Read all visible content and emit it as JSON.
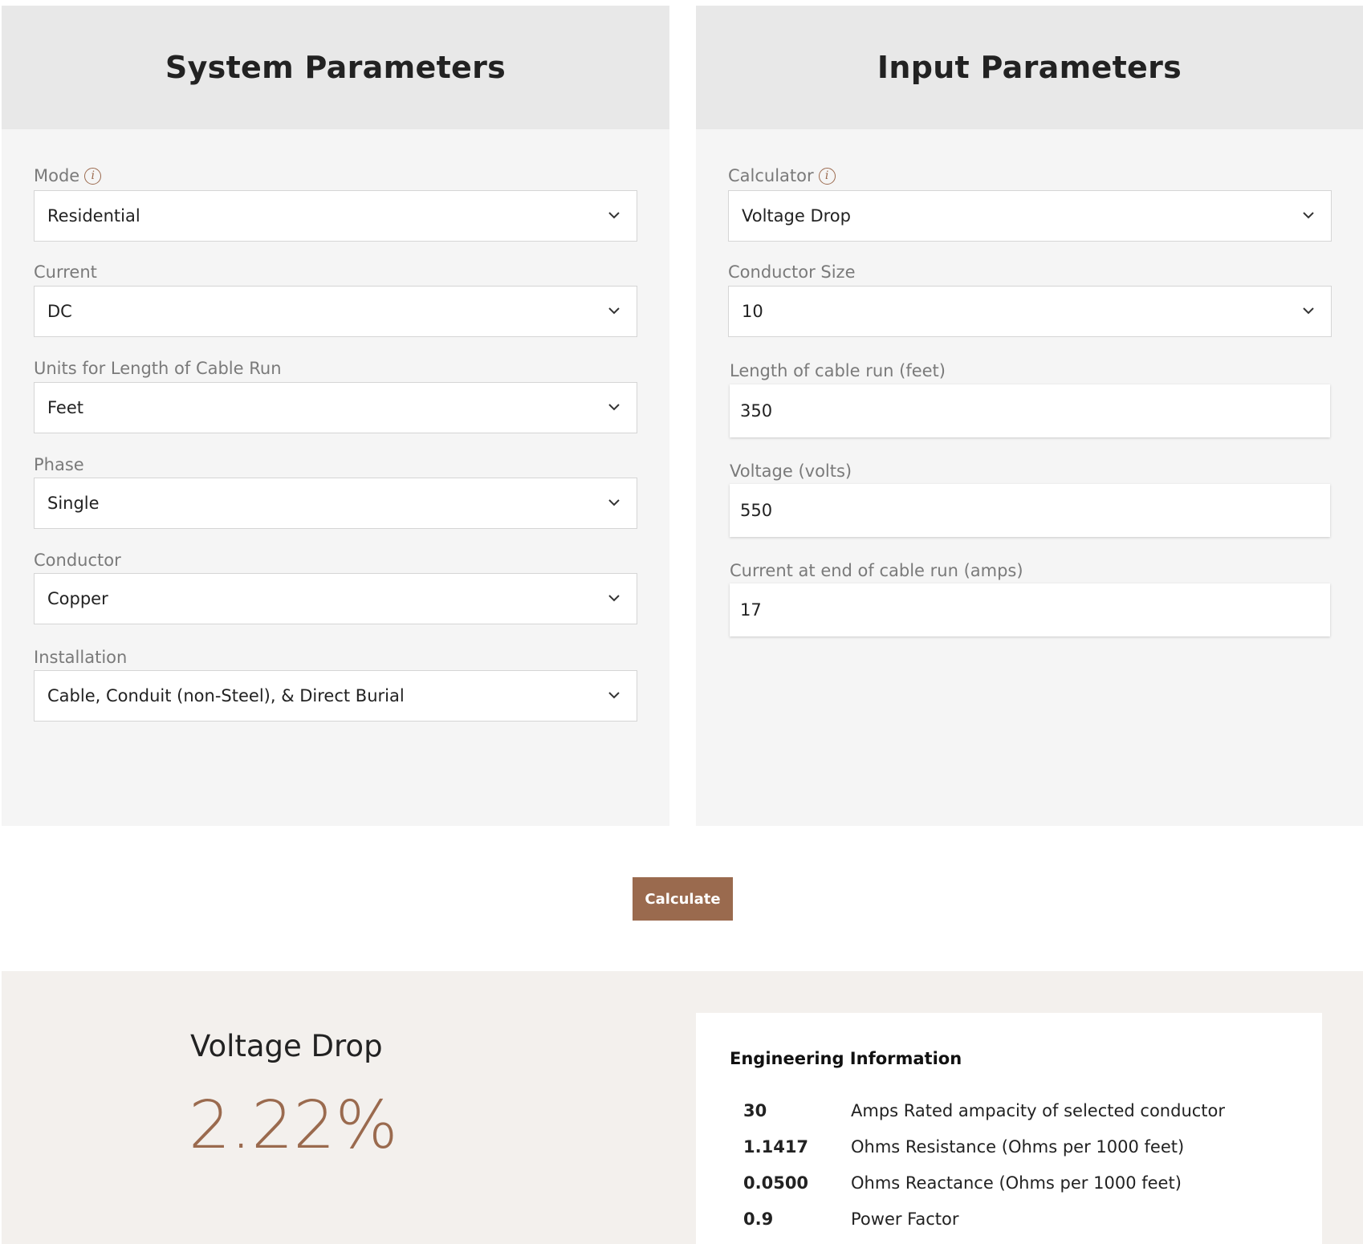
{
  "system": {
    "title": "System Parameters",
    "fields": [
      {
        "label": "Mode",
        "value": "Residential",
        "info": true
      },
      {
        "label": "Current",
        "value": "DC"
      },
      {
        "label": "Units for Length of Cable Run",
        "value": "Feet"
      },
      {
        "label": "Phase",
        "value": "Single"
      },
      {
        "label": "Conductor",
        "value": "Copper"
      },
      {
        "label": "Installation",
        "value": "Cable, Conduit (non-Steel), & Direct Burial"
      }
    ]
  },
  "input": {
    "title": "Input Parameters",
    "calculator": {
      "label": "Calculator",
      "value": "Voltage Drop"
    },
    "conductor_size": {
      "label": "Conductor Size",
      "value": "10"
    },
    "length": {
      "label": "Length of cable run (feet)",
      "value": "350"
    },
    "voltage": {
      "label": "Voltage (volts)",
      "value": "550"
    },
    "current_end": {
      "label": "Current at end of cable run (amps)",
      "value": "17"
    }
  },
  "calculate_label": "Calculate",
  "result": {
    "title": "Voltage Drop",
    "value": "2.22%"
  },
  "engineering": {
    "title": "Engineering Information",
    "rows": [
      {
        "value": "30",
        "text": "Amps Rated ampacity of selected conductor"
      },
      {
        "value": "1.1417",
        "text": "Ohms Resistance (Ohms per 1000 feet)"
      },
      {
        "value": "0.0500",
        "text": "Ohms Reactance (Ohms per 1000 feet)"
      },
      {
        "value": "0.9",
        "text": "Power Factor"
      }
    ]
  },
  "icons": {
    "info": "info-icon",
    "dropdown": "chevron-down-icon"
  },
  "colors": {
    "accent": "#9a6a4e",
    "panel_header": "#e8e8e8",
    "panel_body": "#f5f5f5",
    "results_bg": "#f3f0ed"
  }
}
